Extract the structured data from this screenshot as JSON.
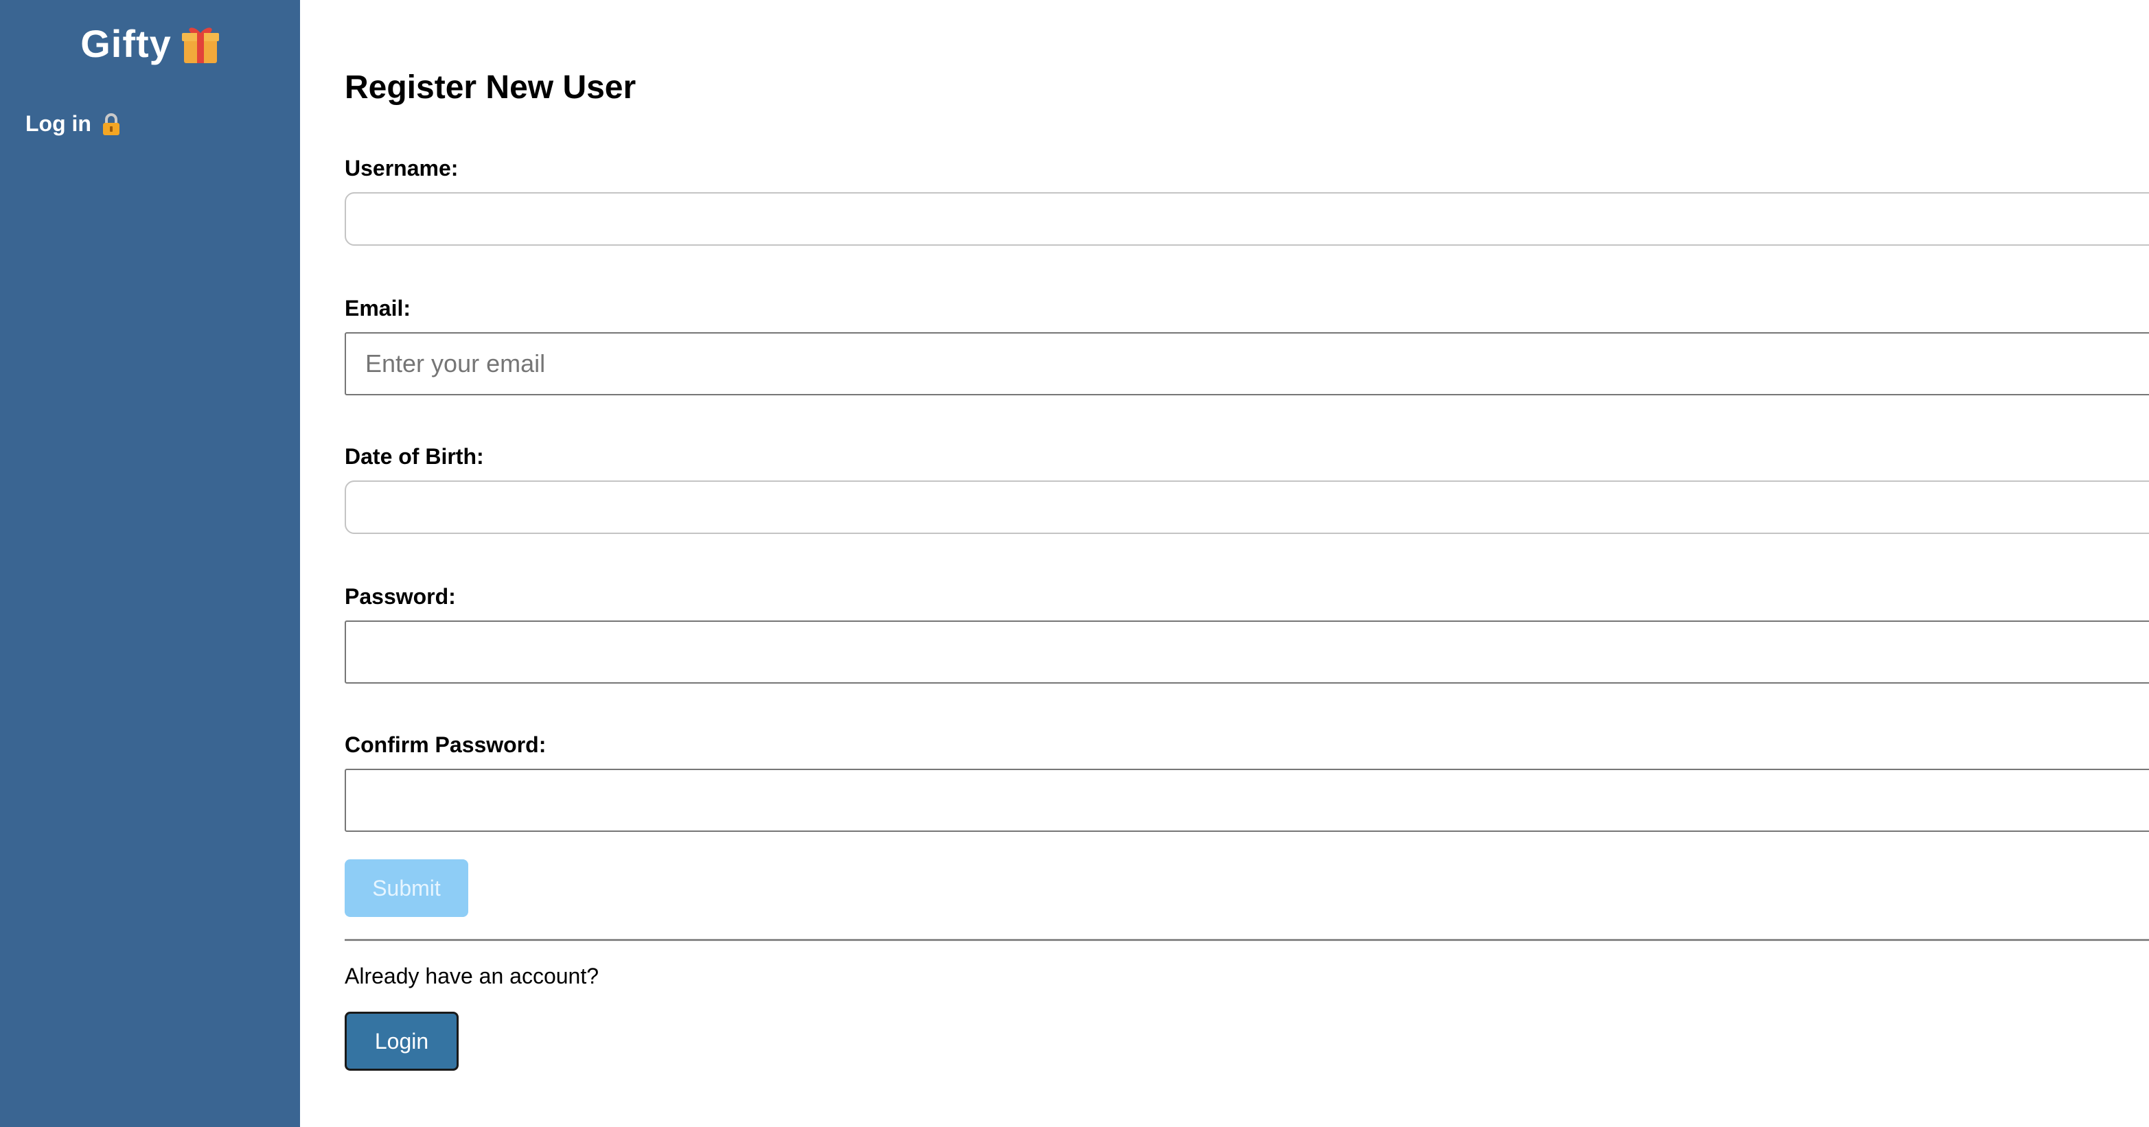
{
  "sidebar": {
    "brand": "Gifty",
    "brand_icon": "gift-icon",
    "nav_login_label": "Log in",
    "nav_login_icon": "lock-icon",
    "background_color": "#3a6592"
  },
  "form": {
    "title": "Register New User",
    "username_label": "Username:",
    "username_value": "",
    "email_label": "Email:",
    "email_placeholder": "Enter your email",
    "dob_label": "Date of Birth:",
    "dob_value": "",
    "password_label": "Password:",
    "confirm_password_label": "Confirm Password:",
    "submit_label": "Submit"
  },
  "footer": {
    "already_text": "Already have an account?",
    "login_label": "Login"
  },
  "colors": {
    "submit_disabled": "#8ecdf6",
    "login_button": "#3574a2"
  }
}
